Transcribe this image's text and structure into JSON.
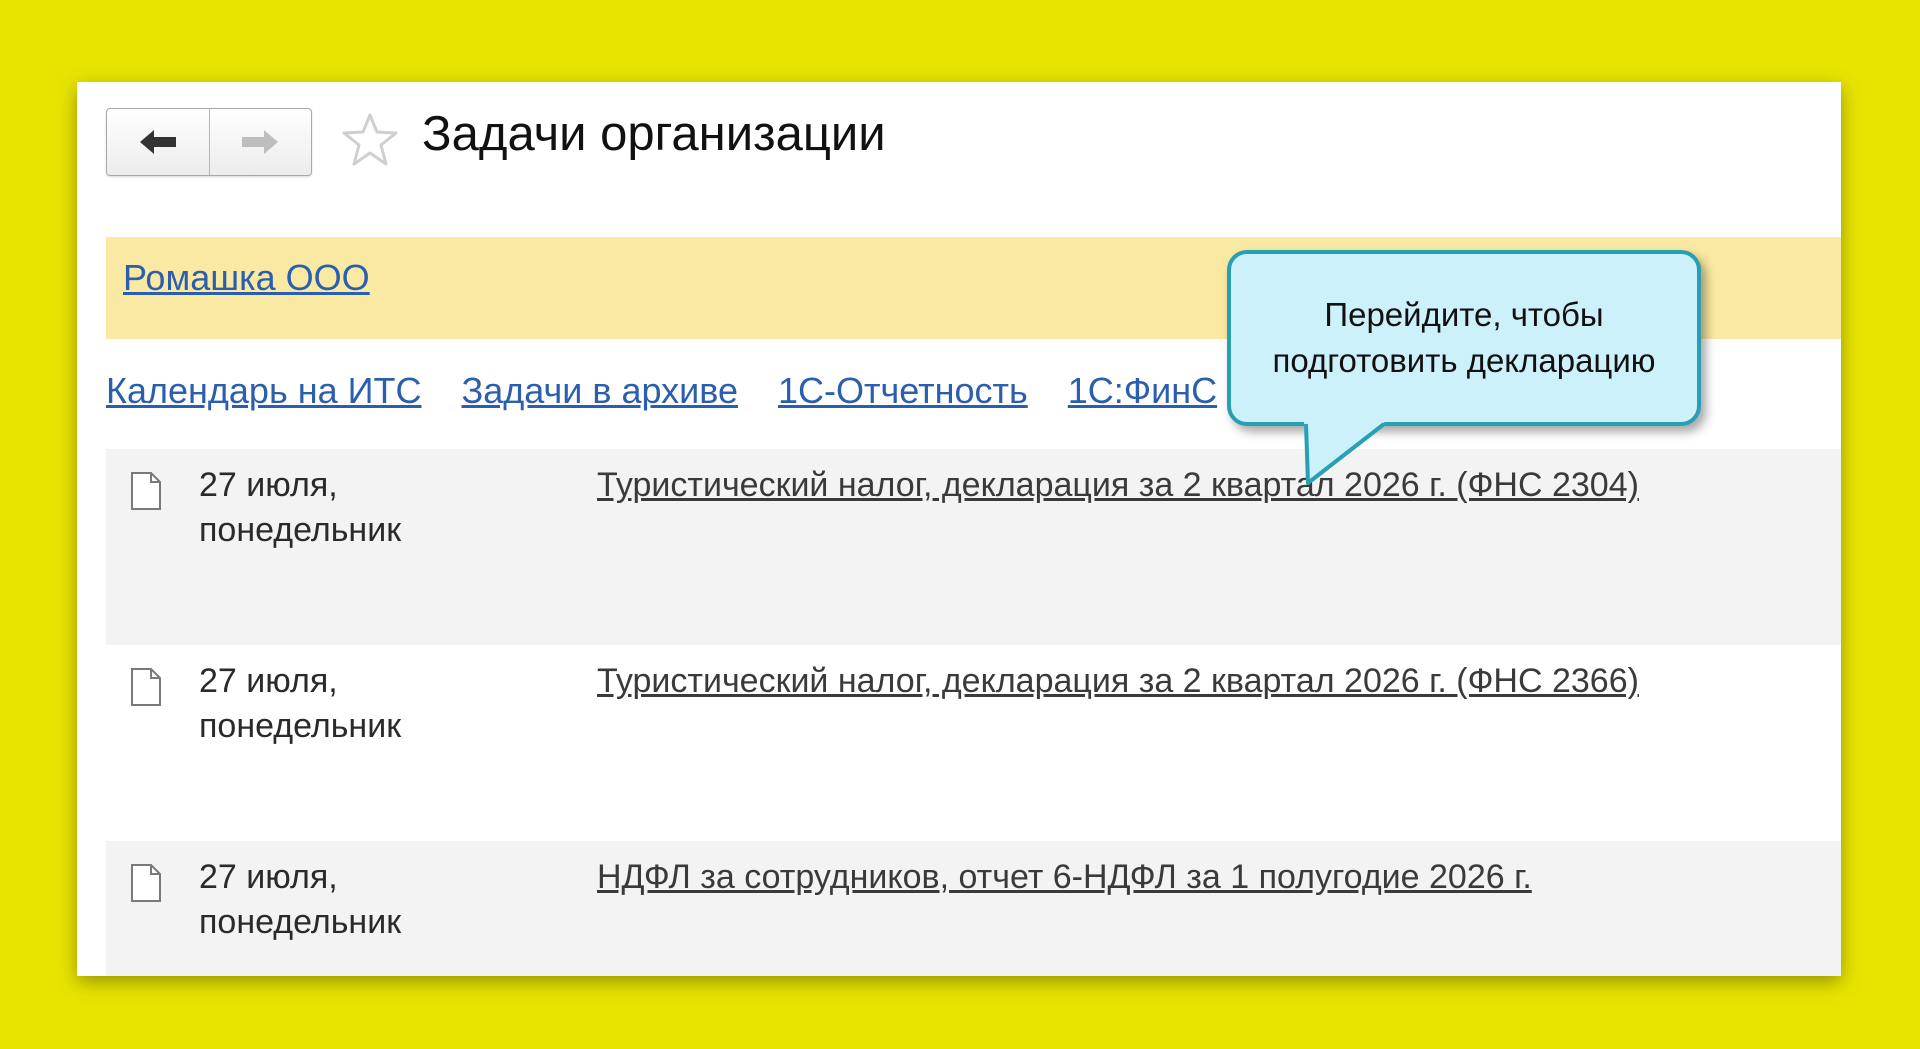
{
  "header": {
    "title": "Задачи организации",
    "back_icon": "arrow-left-icon",
    "forward_icon": "arrow-right-icon",
    "favorite_icon": "star-outline-icon"
  },
  "organization": {
    "name": "Ромашка ООО"
  },
  "links": [
    {
      "label": "Календарь на ИТС"
    },
    {
      "label": "Задачи в архиве"
    },
    {
      "label": "1С-Отчетность"
    },
    {
      "label": "1С:ФинС"
    }
  ],
  "tasks": [
    {
      "date": "27 июля,\nпонедельник",
      "title": "Туристический налог, декларация за 2 квартал 2026 г. (ФНС 2304)"
    },
    {
      "date": "27 июля,\nпонедельник",
      "title": "Туристический налог, декларация за 2 квартал 2026 г. (ФНС 2366)"
    },
    {
      "date": "27 июля,\nпонедельник",
      "title": "НДФЛ за сотрудников, отчет 6-НДФЛ за 1 полугодие 2026 г."
    }
  ],
  "callout": {
    "text": "Перейдите, чтобы подготовить декларацию"
  },
  "colors": {
    "background": "#e8e400",
    "org_bar": "#f9e9a2",
    "link": "#2b5fad",
    "callout_fill": "#cdf1fb",
    "callout_border": "#27a0b4"
  }
}
